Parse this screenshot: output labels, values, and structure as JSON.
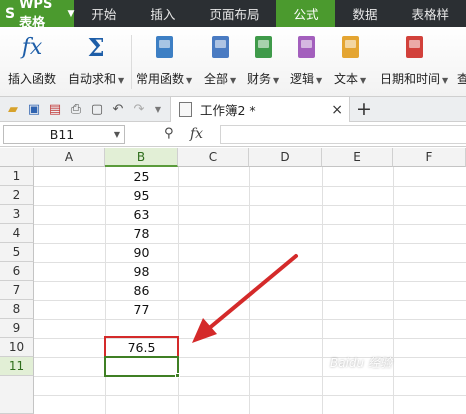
{
  "app": {
    "name": "WPS 表格"
  },
  "menu": {
    "items": [
      "开始",
      "插入",
      "页面布局",
      "公式",
      "数据",
      "表格样"
    ],
    "active": "公式"
  },
  "ribbon": {
    "buttons": [
      {
        "label": "插入函数",
        "dropdown": false,
        "icon": "fx-icon"
      },
      {
        "label": "自动求和",
        "dropdown": true,
        "icon": "sigma-icon"
      },
      {
        "label": "常用函数",
        "dropdown": true,
        "icon": "function-book-icon",
        "color": "#3d7fc4"
      },
      {
        "label": "全部",
        "dropdown": true,
        "icon": "all-functions-book-icon",
        "color": "#4a7bc2"
      },
      {
        "label": "财务",
        "dropdown": true,
        "icon": "finance-book-icon",
        "color": "#3f9a4a"
      },
      {
        "label": "逻辑",
        "dropdown": true,
        "icon": "logic-book-icon",
        "color": "#a35fbd"
      },
      {
        "label": "文本",
        "dropdown": true,
        "icon": "text-book-icon",
        "color": "#e4a532"
      },
      {
        "label": "日期和时间",
        "dropdown": true,
        "icon": "clock-book-icon",
        "color": "#d2413b"
      },
      {
        "label": "查",
        "dropdown": false,
        "icon": "lookup-icon"
      }
    ]
  },
  "toolbar": {
    "doc_tab": "工作簿2 *",
    "close": "×",
    "new_tab": "+"
  },
  "formula_bar": {
    "name_box": "B11",
    "fx": "fx",
    "content": ""
  },
  "sheet": {
    "columns": [
      "A",
      "B",
      "C",
      "D",
      "E",
      "F"
    ],
    "selected_column": "B",
    "rows": [
      "1",
      "2",
      "3",
      "4",
      "5",
      "6",
      "7",
      "8",
      "9",
      "10",
      "11"
    ],
    "selected_row": "11",
    "column_b_values": [
      "25",
      "95",
      "63",
      "78",
      "90",
      "98",
      "86",
      "77",
      "",
      "76.5",
      ""
    ],
    "active_cell": "B11",
    "highlighted_cell": "B10"
  },
  "annotation": {
    "arrow_color": "#d42a2a",
    "box_color": "#d42a2a"
  },
  "watermark": "Baidu 经验"
}
